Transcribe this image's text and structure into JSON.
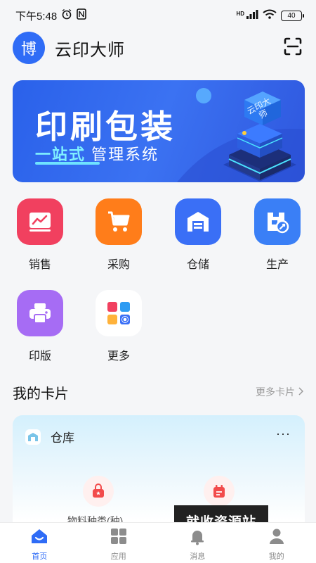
{
  "status_bar": {
    "time": "下午5:48",
    "battery": "40",
    "network": "HD"
  },
  "header": {
    "avatar_text": "博",
    "title": "云印大师"
  },
  "banner": {
    "title": "印刷包装",
    "subtitle_highlight": "一站式",
    "subtitle_rest": "管理系统",
    "cube_text": "云印大师"
  },
  "grid": {
    "items": [
      {
        "label": "销售",
        "icon": "sales-chart-icon",
        "color": "#f1405f"
      },
      {
        "label": "采购",
        "icon": "cart-icon",
        "color": "#ff7d1a"
      },
      {
        "label": "仓储",
        "icon": "warehouse-icon",
        "color": "#3a6ff6"
      },
      {
        "label": "生产",
        "icon": "production-icon",
        "color": "#3a7ff6"
      },
      {
        "label": "印版",
        "icon": "printer-icon",
        "color": "#a66cf4"
      },
      {
        "label": "更多",
        "icon": "more-apps-icon",
        "color": "#ffffff"
      }
    ]
  },
  "cards_section": {
    "title": "我的卡片",
    "more_link": "更多卡片"
  },
  "warehouse_card": {
    "title": "仓库",
    "menu": "···",
    "stats": [
      {
        "label": "物料种类(种)",
        "icon": "bag-icon"
      },
      {
        "label": "",
        "icon": "calendar-icon"
      }
    ]
  },
  "watermark": "就收资源站",
  "tabbar": {
    "tabs": [
      {
        "label": "首页",
        "icon": "home-icon",
        "active": true
      },
      {
        "label": "应用",
        "icon": "apps-icon",
        "active": false
      },
      {
        "label": "消息",
        "icon": "bell-icon",
        "active": false
      },
      {
        "label": "我的",
        "icon": "user-icon",
        "active": false
      }
    ]
  }
}
